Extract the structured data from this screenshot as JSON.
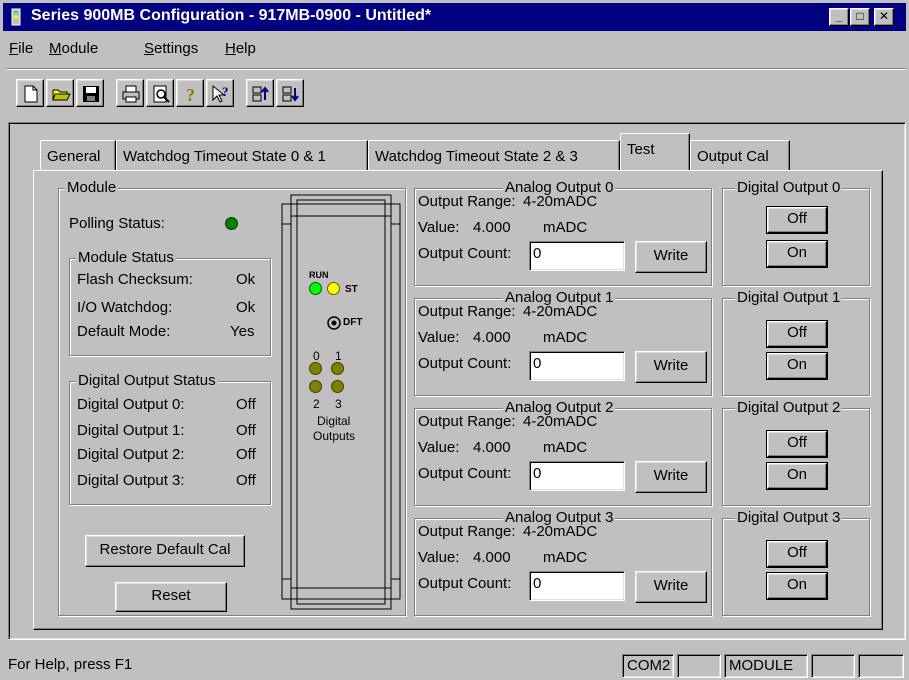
{
  "window": {
    "title": "Series 900MB Configuration - 917MB-0900 - Untitled*",
    "minimize_glyph": "_",
    "maximize_glyph": "□",
    "close_glyph": "✕"
  },
  "menu": [
    {
      "label_acc": "F",
      "label_rest": "ile"
    },
    {
      "label_acc": "M",
      "label_rest": "odule"
    },
    {
      "label_acc": "S",
      "label_rest": "ettings"
    },
    {
      "label_acc": "H",
      "label_rest": "elp"
    }
  ],
  "toolbar_icons": [
    "new-file-icon",
    "open-folder-icon",
    "save-icon",
    "print-icon",
    "print-preview-icon",
    "help-icon",
    "context-help-icon",
    "upload-icon",
    "download-icon"
  ],
  "tabs": [
    "General",
    "Watchdog Timeout State 0 & 1",
    "Watchdog Timeout State 2 & 3",
    "Test",
    "Output Cal"
  ],
  "active_tab": "Test",
  "module": {
    "legend": "Module",
    "polling_label": "Polling Status:",
    "polling_color": "#008000",
    "status": {
      "legend": "Module Status",
      "rows": [
        {
          "label": "Flash Checksum:",
          "value": "Ok"
        },
        {
          "label": "I/O Watchdog:",
          "value": "Ok"
        },
        {
          "label": "Default Mode:",
          "value": "Yes"
        }
      ]
    },
    "digital_status": {
      "legend": "Digital Output Status",
      "rows": [
        {
          "label": "Digital Output 0:",
          "value": "Off"
        },
        {
          "label": "Digital Output 1:",
          "value": "Off"
        },
        {
          "label": "Digital Output 2:",
          "value": "Off"
        },
        {
          "label": "Digital Output 3:",
          "value": "Off"
        }
      ]
    },
    "restore_label": "Restore Default Cal",
    "reset_label": "Reset"
  },
  "device": {
    "run_label": "RUN",
    "st_label": "ST",
    "dft_label": "DFT",
    "num0": "0",
    "num1": "1",
    "num2": "2",
    "num3": "3",
    "digital_label_1": "Digital",
    "digital_label_2": "Outputs",
    "run_color": "#00ff00",
    "st_color": "#ffff00",
    "digital_led_color": "#808000"
  },
  "analog_outputs": [
    {
      "legend": "Analog Output 0",
      "range_label": "Output Range:",
      "range_value": "4-20mADC",
      "value_label": "Value:",
      "value": "4.000",
      "unit": "mADC",
      "count_label": "Output Count:",
      "count": "0",
      "write_label": "Write"
    },
    {
      "legend": "Analog Output 1",
      "range_label": "Output Range:",
      "range_value": "4-20mADC",
      "value_label": "Value:",
      "value": "4.000",
      "unit": "mADC",
      "count_label": "Output Count:",
      "count": "0",
      "write_label": "Write"
    },
    {
      "legend": "Analog Output 2",
      "range_label": "Output Range:",
      "range_value": "4-20mADC",
      "value_label": "Value:",
      "value": "4.000",
      "unit": "mADC",
      "count_label": "Output Count:",
      "count": "0",
      "write_label": "Write"
    },
    {
      "legend": "Analog Output 3",
      "range_label": "Output Range:",
      "range_value": "4-20mADC",
      "value_label": "Value:",
      "value": "4.000",
      "unit": "mADC",
      "count_label": "Output Count:",
      "count": "0",
      "write_label": "Write"
    }
  ],
  "digital_outputs": [
    {
      "legend": "Digital Output 0",
      "off_label": "Off",
      "on_label": "On"
    },
    {
      "legend": "Digital Output 1",
      "off_label": "Off",
      "on_label": "On"
    },
    {
      "legend": "Digital Output 2",
      "off_label": "Off",
      "on_label": "On"
    },
    {
      "legend": "Digital Output 3",
      "off_label": "Off",
      "on_label": "On"
    }
  ],
  "statusbar": {
    "help_text": "For Help, press F1",
    "port": "COM2",
    "mode": "MODULE"
  }
}
